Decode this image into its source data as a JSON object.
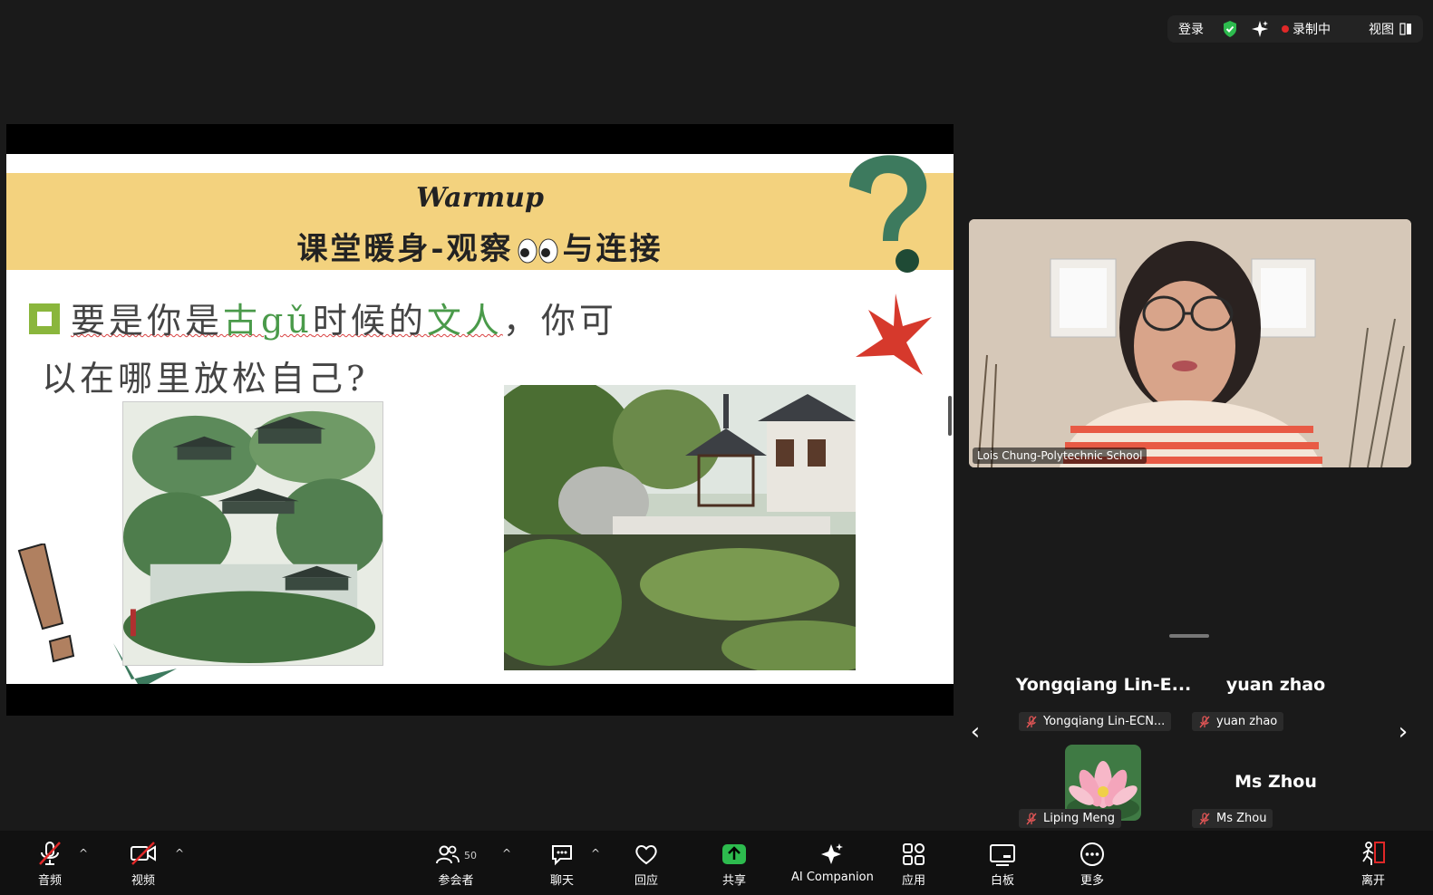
{
  "top_bar": {
    "login": "登录",
    "recording": "录制中",
    "view": "视图"
  },
  "slide": {
    "title_en": "Warmup",
    "title_zh_1": "课堂暖身-观察",
    "title_zh_2": "与连接",
    "q_1": "要是你是",
    "q_2": "古gǔ",
    "q_3": "时候的",
    "q_4": "文人",
    "q_5": "，你可",
    "q_6": "以在哪里放松自己?"
  },
  "speaker": {
    "name": "Lois Chung-Polytechnic School"
  },
  "gallery": {
    "tiles": [
      {
        "display": "Yongqiang  Lin-E...",
        "tag": "Yongqiang Lin-ECN..."
      },
      {
        "display": "yuan zhao",
        "tag": "yuan zhao"
      },
      {
        "display": "",
        "tag": "Liping Meng"
      },
      {
        "display": "Ms Zhou",
        "tag": "Ms Zhou"
      }
    ]
  },
  "toolbar": {
    "audio": "音频",
    "video": "视频",
    "participants": "参会者",
    "participants_count": "50",
    "chat": "聊天",
    "react": "回应",
    "share": "共享",
    "ai": "AI Companion",
    "apps": "应用",
    "whiteboard": "白板",
    "more": "更多",
    "leave": "离开"
  },
  "colors": {
    "share_green": "#2dbb4e",
    "leave_red": "#e02828",
    "banner_yellow": "#f3d27e",
    "accent_green": "#8ab63c"
  }
}
